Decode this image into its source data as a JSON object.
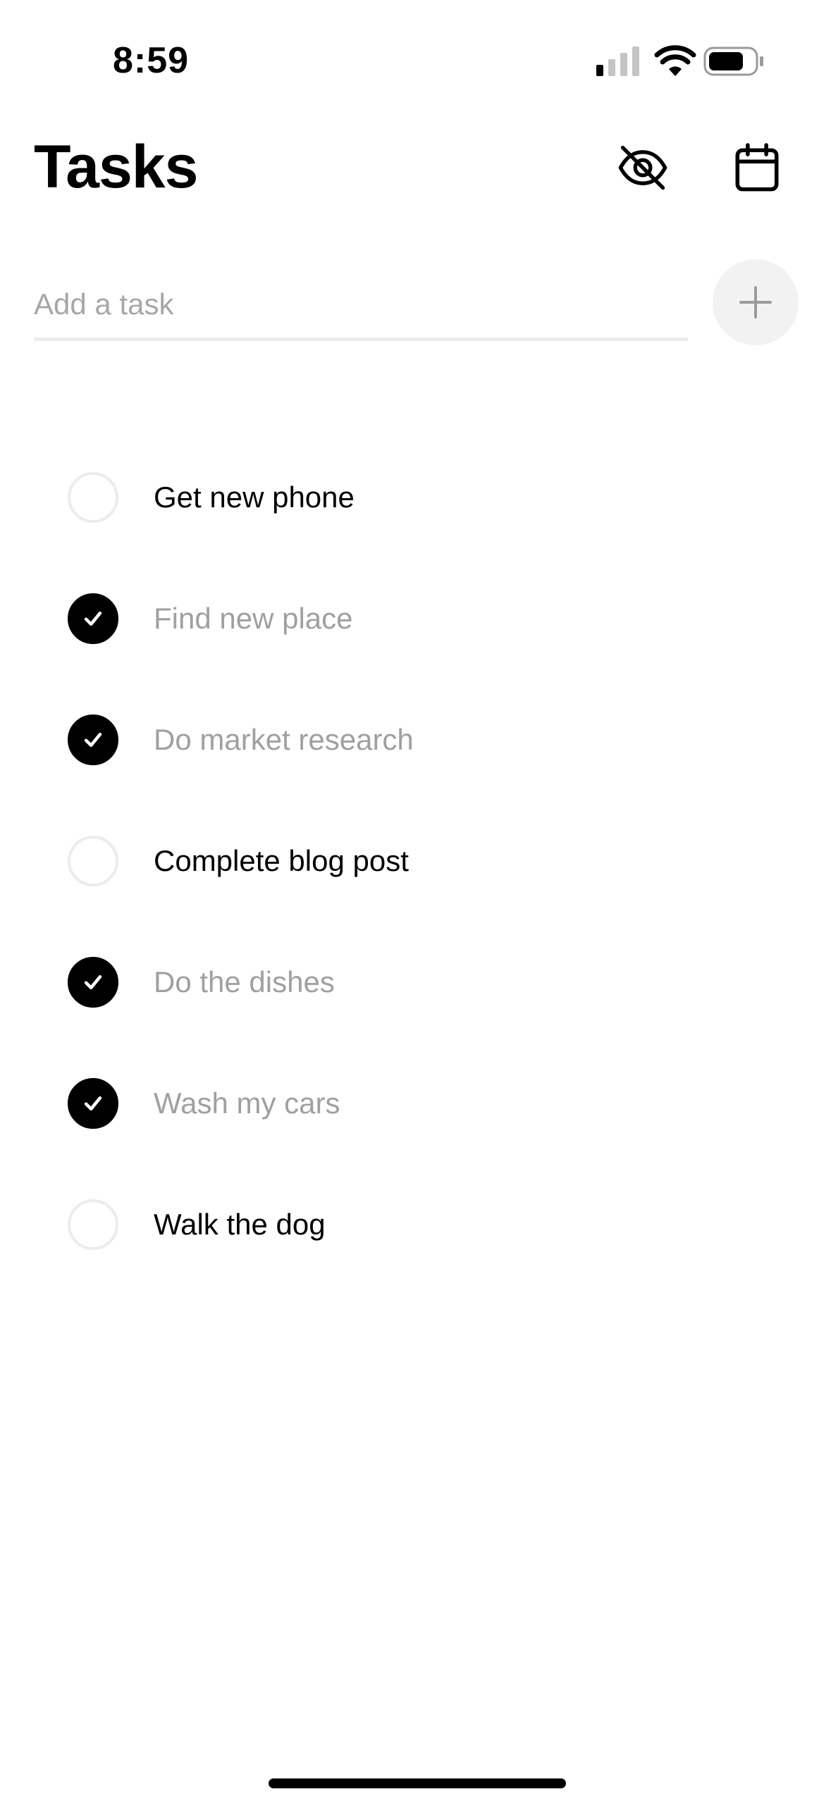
{
  "status_bar": {
    "time": "8:59",
    "icons": [
      "cellular-signal-icon",
      "wifi-icon",
      "battery-icon"
    ]
  },
  "header": {
    "title": "Tasks",
    "actions": [
      "eye-slash-icon",
      "calendar-icon"
    ]
  },
  "add_task": {
    "placeholder": "Add a task",
    "value": "",
    "button_icon": "plus-icon"
  },
  "tasks": [
    {
      "label": "Get new phone",
      "completed": false
    },
    {
      "label": "Find new place",
      "completed": true
    },
    {
      "label": "Do market research",
      "completed": true
    },
    {
      "label": "Complete blog post",
      "completed": false
    },
    {
      "label": "Do the dishes",
      "completed": true
    },
    {
      "label": "Wash my cars",
      "completed": true
    },
    {
      "label": "Walk the dog",
      "completed": false
    }
  ],
  "colors": {
    "text": "#000000",
    "completed_text": "#a0a0a0",
    "checked_fill": "#000000",
    "unchecked_border": "#ececec",
    "add_button_bg": "#f2f2f2"
  }
}
